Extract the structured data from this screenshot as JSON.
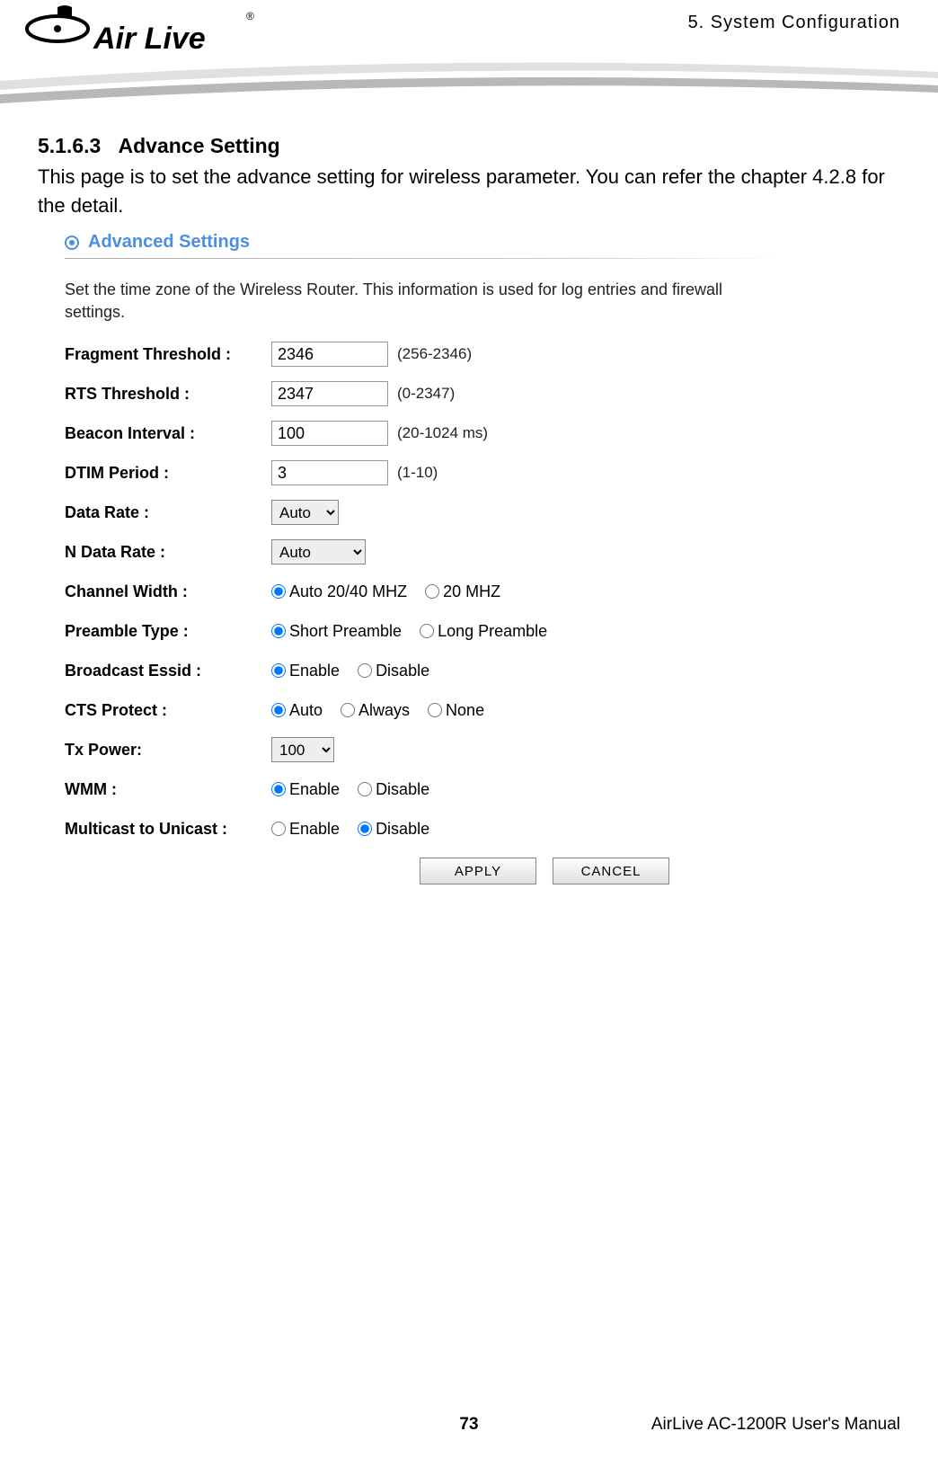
{
  "header": {
    "chapter": "5. System Configuration"
  },
  "logo": {
    "brand_text": "Air Live",
    "registered": "®"
  },
  "section": {
    "number": "5.1.6.3",
    "title": "Advance Setting",
    "body": "This page is to set the advance setting for wireless parameter. You can refer the chapter 4.2.8 for the detail."
  },
  "panel": {
    "title": "Advanced Settings",
    "description": "Set the time zone of the Wireless Router. This information is used for log entries and firewall settings."
  },
  "form": {
    "fragment_threshold": {
      "label": "Fragment Threshold :",
      "value": "2346",
      "hint": "(256-2346)"
    },
    "rts_threshold": {
      "label": "RTS Threshold :",
      "value": "2347",
      "hint": "(0-2347)"
    },
    "beacon_interval": {
      "label": "Beacon Interval :",
      "value": "100",
      "hint": "(20-1024 ms)"
    },
    "dtim_period": {
      "label": "DTIM Period :",
      "value": "3",
      "hint": "(1-10)"
    },
    "data_rate": {
      "label": "Data Rate :",
      "value": "Auto"
    },
    "n_data_rate": {
      "label": "N Data Rate :",
      "value": "Auto"
    },
    "channel_width": {
      "label": "Channel Width :",
      "opt1": "Auto 20/40 MHZ",
      "opt2": "20 MHZ",
      "selected": "Auto 20/40 MHZ"
    },
    "preamble_type": {
      "label": "Preamble Type :",
      "opt1": "Short Preamble",
      "opt2": "Long Preamble",
      "selected": "Short Preamble"
    },
    "broadcast_essid": {
      "label": "Broadcast Essid :",
      "opt1": "Enable",
      "opt2": "Disable",
      "selected": "Enable"
    },
    "cts_protect": {
      "label": "CTS Protect :",
      "opt1": "Auto",
      "opt2": "Always",
      "opt3": "None",
      "selected": "Auto"
    },
    "tx_power": {
      "label": "Tx Power:",
      "value": "100"
    },
    "wmm": {
      "label": "WMM :",
      "opt1": "Enable",
      "opt2": "Disable",
      "selected": "Enable"
    },
    "multicast": {
      "label": "Multicast to Unicast :",
      "opt1": "Enable",
      "opt2": "Disable",
      "selected": "Disable"
    }
  },
  "buttons": {
    "apply": "APPLY",
    "cancel": "CANCEL"
  },
  "footer": {
    "page": "73",
    "manual": "AirLive AC-1200R User's Manual"
  }
}
